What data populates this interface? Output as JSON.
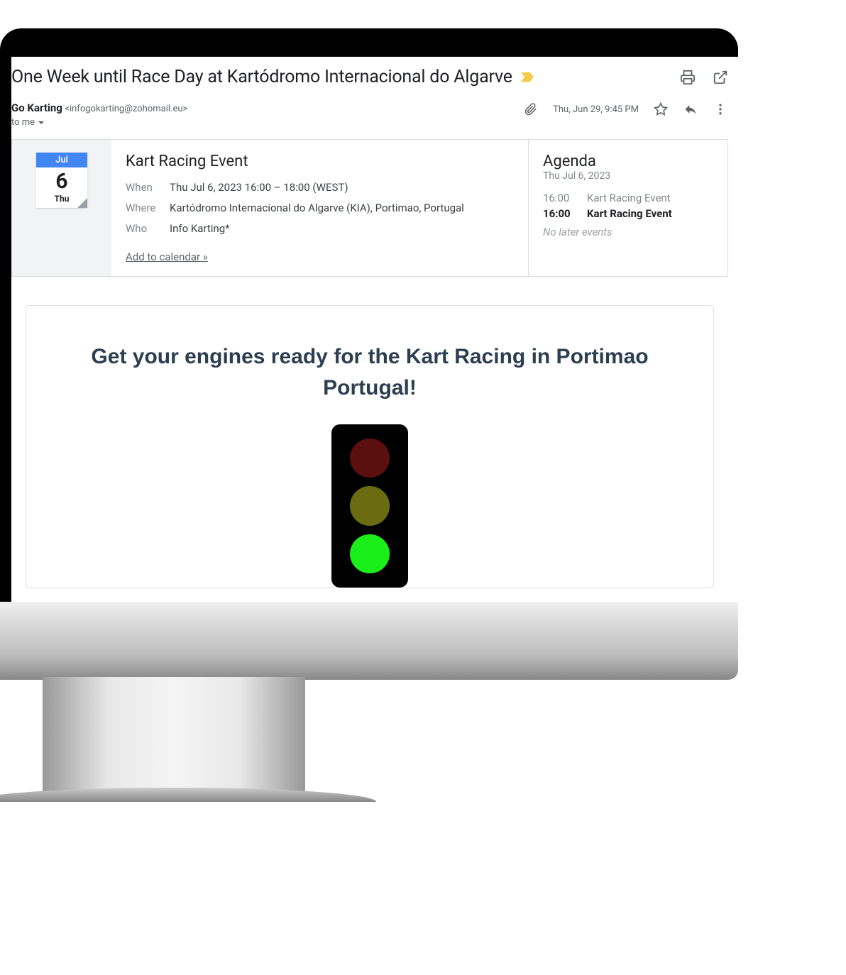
{
  "email": {
    "subject": "One Week until Race Day at Kartódromo Internacional do Algarve",
    "sender_name": "Go Karting",
    "sender_email": "<infogokarting@zohomail.eu>",
    "recipient": "to me",
    "timestamp": "Thu, Jun 29, 9:45 PM"
  },
  "calendar_badge": {
    "month": "Jul",
    "day": "6",
    "weekday": "Thu"
  },
  "event": {
    "title": "Kart Racing Event",
    "when_label": "When",
    "when_value": "Thu Jul 6, 2023 16:00 – 18:00 (WEST)",
    "where_label": "Where",
    "where_value": "Kartódromo Internacional do Algarve (KIA), Portimao, Portugal",
    "who_label": "Who",
    "who_value": "Info Karting*",
    "add_link": "Add to calendar »"
  },
  "agenda": {
    "title": "Agenda",
    "date": "Thu Jul 6, 2023",
    "items": [
      {
        "time": "16:00",
        "text": "Kart Racing Event",
        "bold": false
      },
      {
        "time": "16:00",
        "text": "Kart Racing Event",
        "bold": true
      }
    ],
    "no_later": "No later events"
  },
  "body": {
    "heading": "Get your engines ready for the Kart Racing in Portimao Portugal!"
  }
}
